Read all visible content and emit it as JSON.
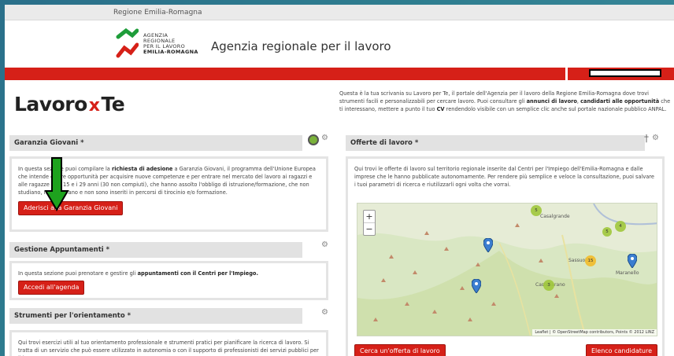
{
  "topbar": {
    "region": "Regione Emilia-Romagna"
  },
  "header": {
    "logo_lines": [
      "AGENZIA",
      "REGIONALE",
      "PER IL LAVORO",
      "EMILIA-ROMAGNA"
    ],
    "title": "Agenzia regionale per il lavoro"
  },
  "brand": {
    "part1": "Lavoro",
    "x": "x",
    "part2": "Te"
  },
  "intro": {
    "t1": "Questa è la tua scrivania su Lavoro per Te, il portale dell'Agenzia per il lavoro della Regione Emilia-Romagna dove trovi strumenti facili e personalizzabili per cercare lavoro. Puoi consultare gli ",
    "b1": "annunci di lavoro",
    "t2": ", ",
    "b2": "candidarti alle opportunità",
    "t3": " che ti interessano, mettere a punto il tuo ",
    "b3": "CV",
    "t4": " rendendolo visibile con un semplice clic anche sul portale nazionale pubblico ANPAL."
  },
  "garanzia": {
    "title": "Garanzia Giovani *",
    "text_pre": "In questa sezione puoi compilare la ",
    "text_bold": "richiesta di adesione",
    "text_mid": " a Garanzia Giovani, il programma dell'Unione Europea che intende offrire opportunità per acquisire nuove competenze e per entrare nel mercato del lavoro ai ragazzi e alle ragazze fra i 15 e i 29 anni (30 non compiuti), che hanno assolto l'obbligo di istruzione/formazione, che non studiano, non lavorano e non sono inseriti in percorsi di tirocinio e/o formazione.",
    "button": "Aderisci alla Garanzia Giovani"
  },
  "appuntamenti": {
    "title": "Gestione Appuntamenti *",
    "text_pre": "In questa sezione puoi prenotare e gestire gli ",
    "text_bold": "appuntamenti con il Centri per l'Impiego.",
    "button": "Accedi all'agenda"
  },
  "orientamento": {
    "title": "Strumenti per l'orientamento *",
    "text": "Qui trovi esercizi utili al tuo orientamento professionale e strumenti pratici per pianificare la ricerca di lavoro. Si tratta di un servizio che può essere utilizzato in autonomia o con il supporto di professionisti dei servizi pubblici per il lavoro"
  },
  "offerte": {
    "title": "Offerte di lavoro *",
    "text": "Qui trovi le offerte di lavoro sul territorio regionale inserite dal Centri per l'Impiego dell'Emilia-Romagna e dalle imprese che le hanno pubblicate autonomamente. Per rendere più semplice e veloce la consultazione, puoi salvare i tuoi parametri di ricerca e riutilizzarli ogni volta che vorrai.",
    "button_search": "Cerca un'offerta di lavoro",
    "button_list": "Elenco candidature"
  },
  "map": {
    "zoom_in": "+",
    "zoom_out": "−",
    "attribution": "Leaflet | © OpenStreetMap contributors, Points © 2012 LINZ",
    "labels": [
      "Casalgrande",
      "Sassuolo",
      "Maranello",
      "Castellarano"
    ],
    "clusters": [
      "5",
      "4",
      "15",
      "5",
      "3"
    ]
  },
  "colors": {
    "accent": "#d62018",
    "arrow": "#1ea21e"
  }
}
